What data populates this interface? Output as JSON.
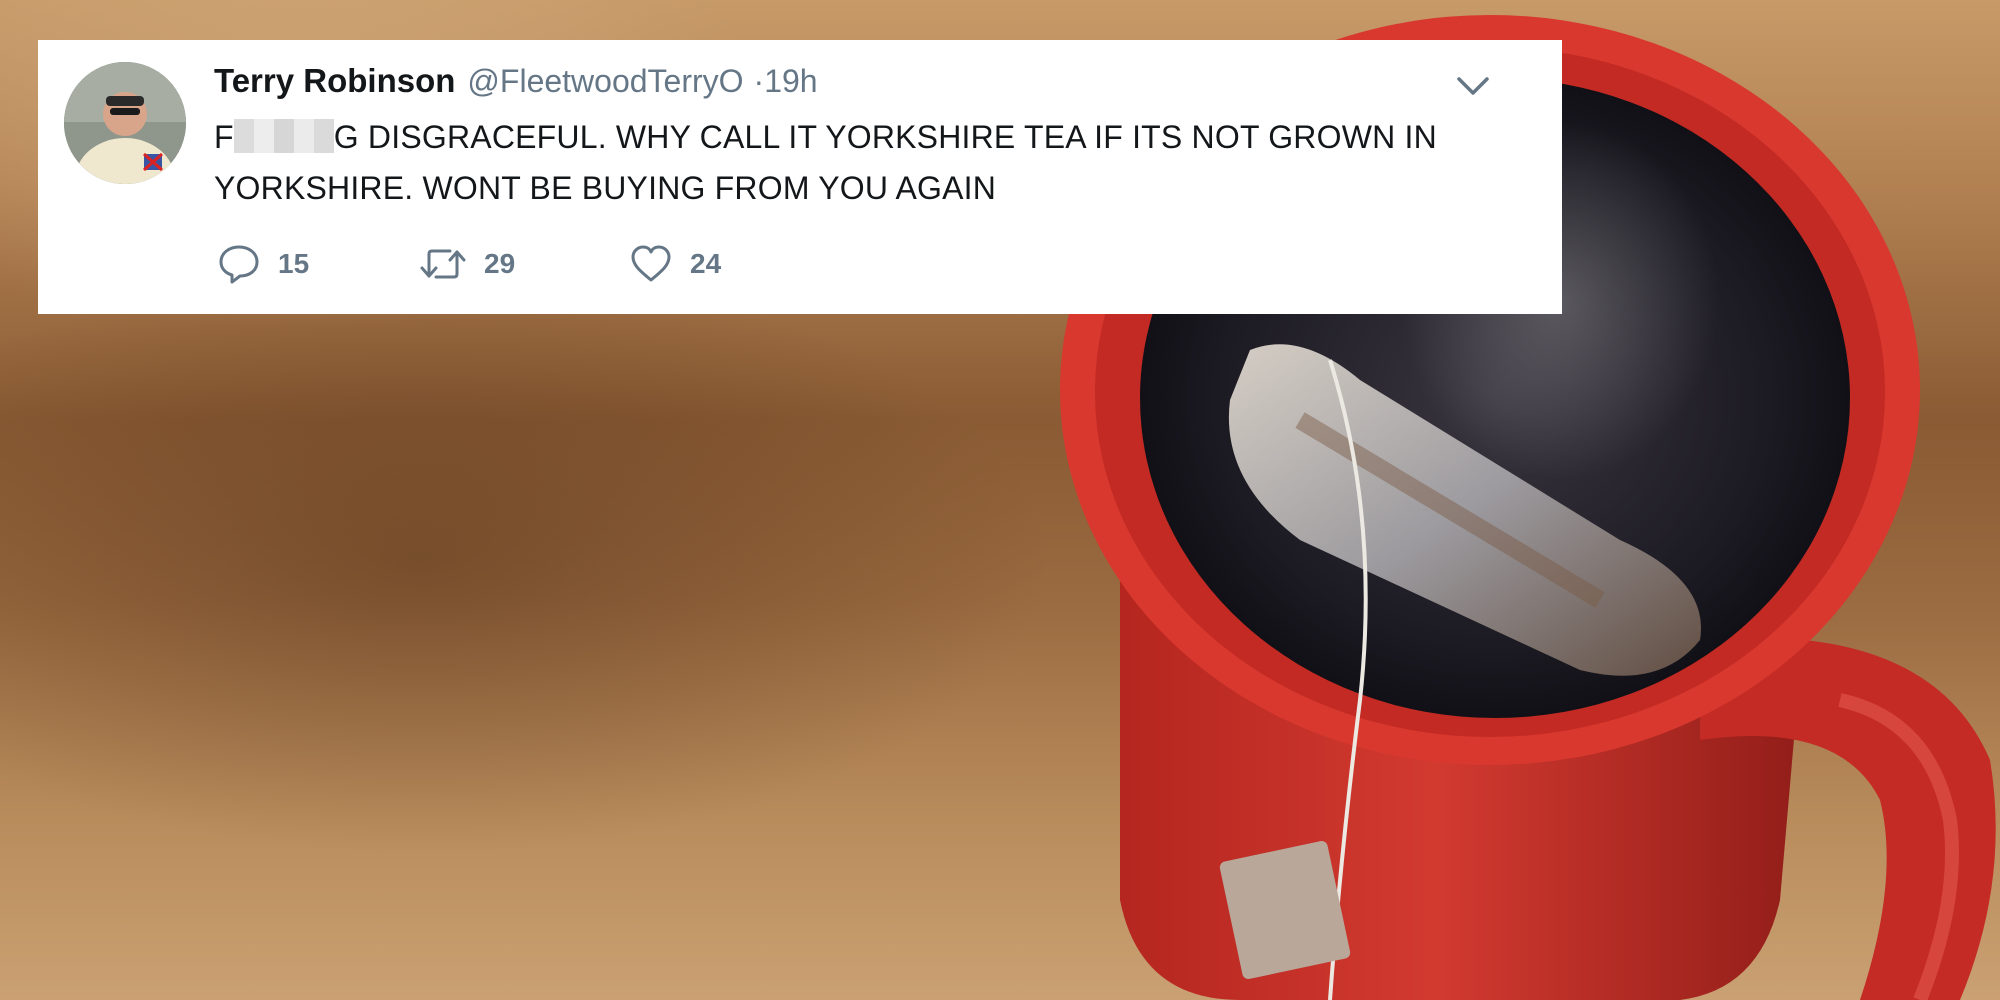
{
  "tweet": {
    "display_name": "Terry Robinson",
    "handle": "@FleetwoodTerryO",
    "time": "·19h",
    "text_prefix": "F",
    "text_rest": "G DISGRACEFUL. WHY CALL IT YORKSHIRE TEA IF ITS NOT GROWN IN YORKSHIRE. WONT BE BUYING FROM YOU AGAIN",
    "reply_count": "15",
    "retweet_count": "29",
    "like_count": "24"
  },
  "icons": {
    "more": "chevron-down-icon",
    "reply": "reply-icon",
    "retweet": "retweet-icon",
    "like": "heart-icon"
  },
  "colors": {
    "text": "#14171a",
    "muted": "#657786",
    "card": "#ffffff",
    "mug": "#d8352f"
  }
}
